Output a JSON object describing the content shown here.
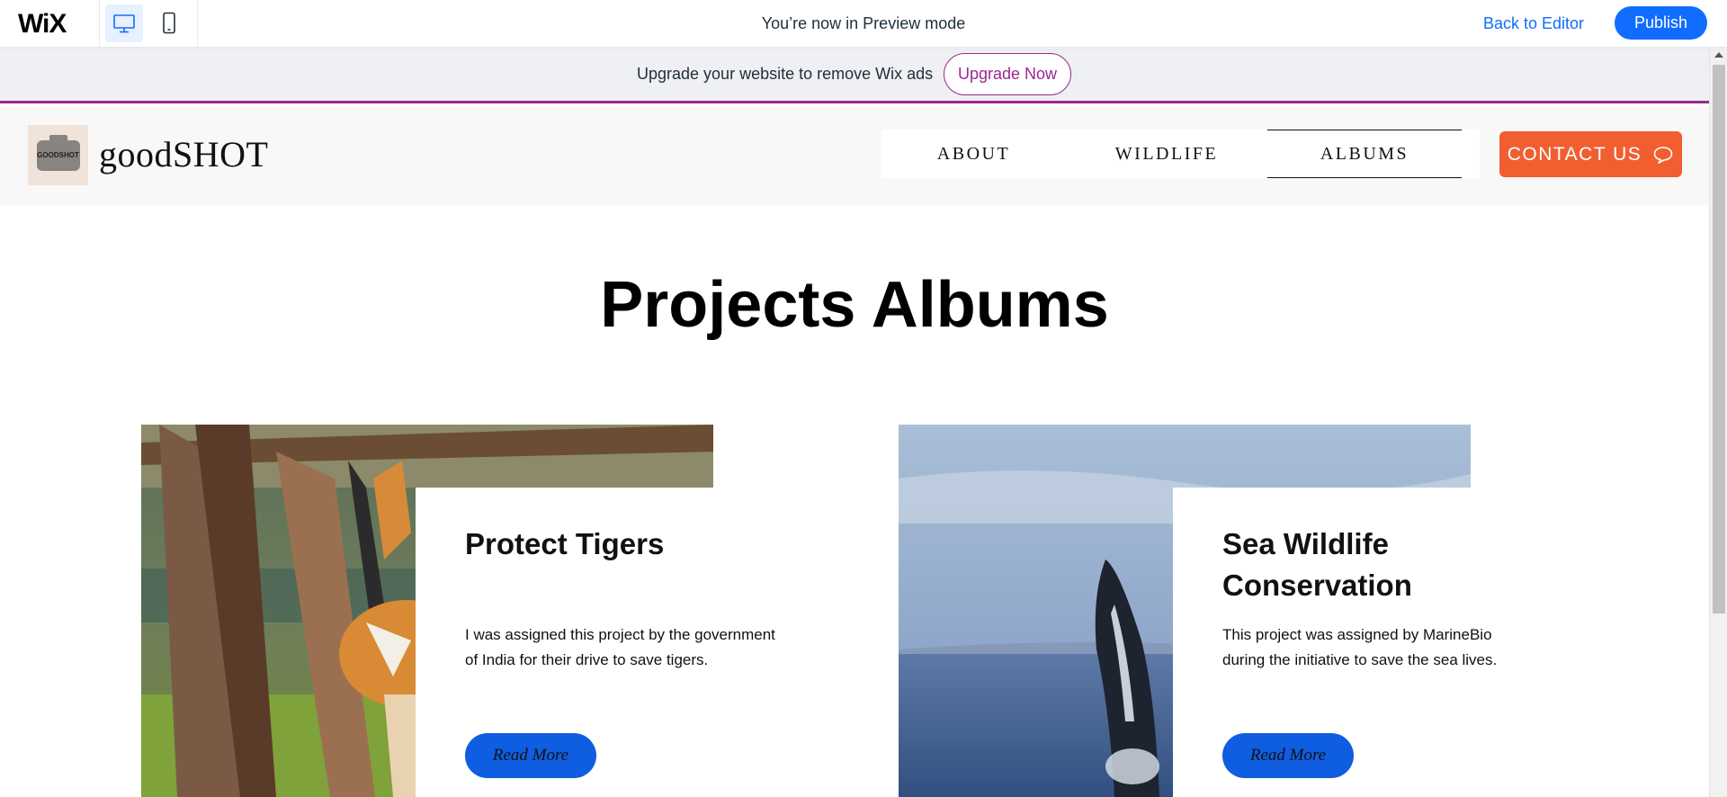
{
  "topbar": {
    "logo": "WiX",
    "preview_text": "You’re now in Preview mode",
    "back_to_editor": "Back to Editor",
    "publish": "Publish",
    "colors": {
      "accent": "#116dff"
    }
  },
  "ads": {
    "text": "Upgrade your website to remove Wix ads",
    "upgrade_button": "Upgrade Now",
    "color": "#9a2892"
  },
  "site": {
    "logo_text": "GOODSHOT",
    "name": "goodSHOT",
    "nav": [
      {
        "label": "ABOUT",
        "active": false
      },
      {
        "label": "WILDLIFE",
        "active": false
      },
      {
        "label": "ALBUMS",
        "active": true
      }
    ],
    "contact_button": "CONTACT US",
    "contact_color": "#f15f31"
  },
  "main": {
    "title": "Projects Albums",
    "cards": [
      {
        "title": "Protect Tigers",
        "description": "I was assigned this project by the government of India for their drive to save tigers.",
        "button": "Read More"
      },
      {
        "title": "Sea Wildlife Conservation",
        "description": "This project was assigned by MarineBio during the initiative to save the sea lives.",
        "button": "Read More"
      }
    ],
    "button_color": "#0f5de0"
  }
}
